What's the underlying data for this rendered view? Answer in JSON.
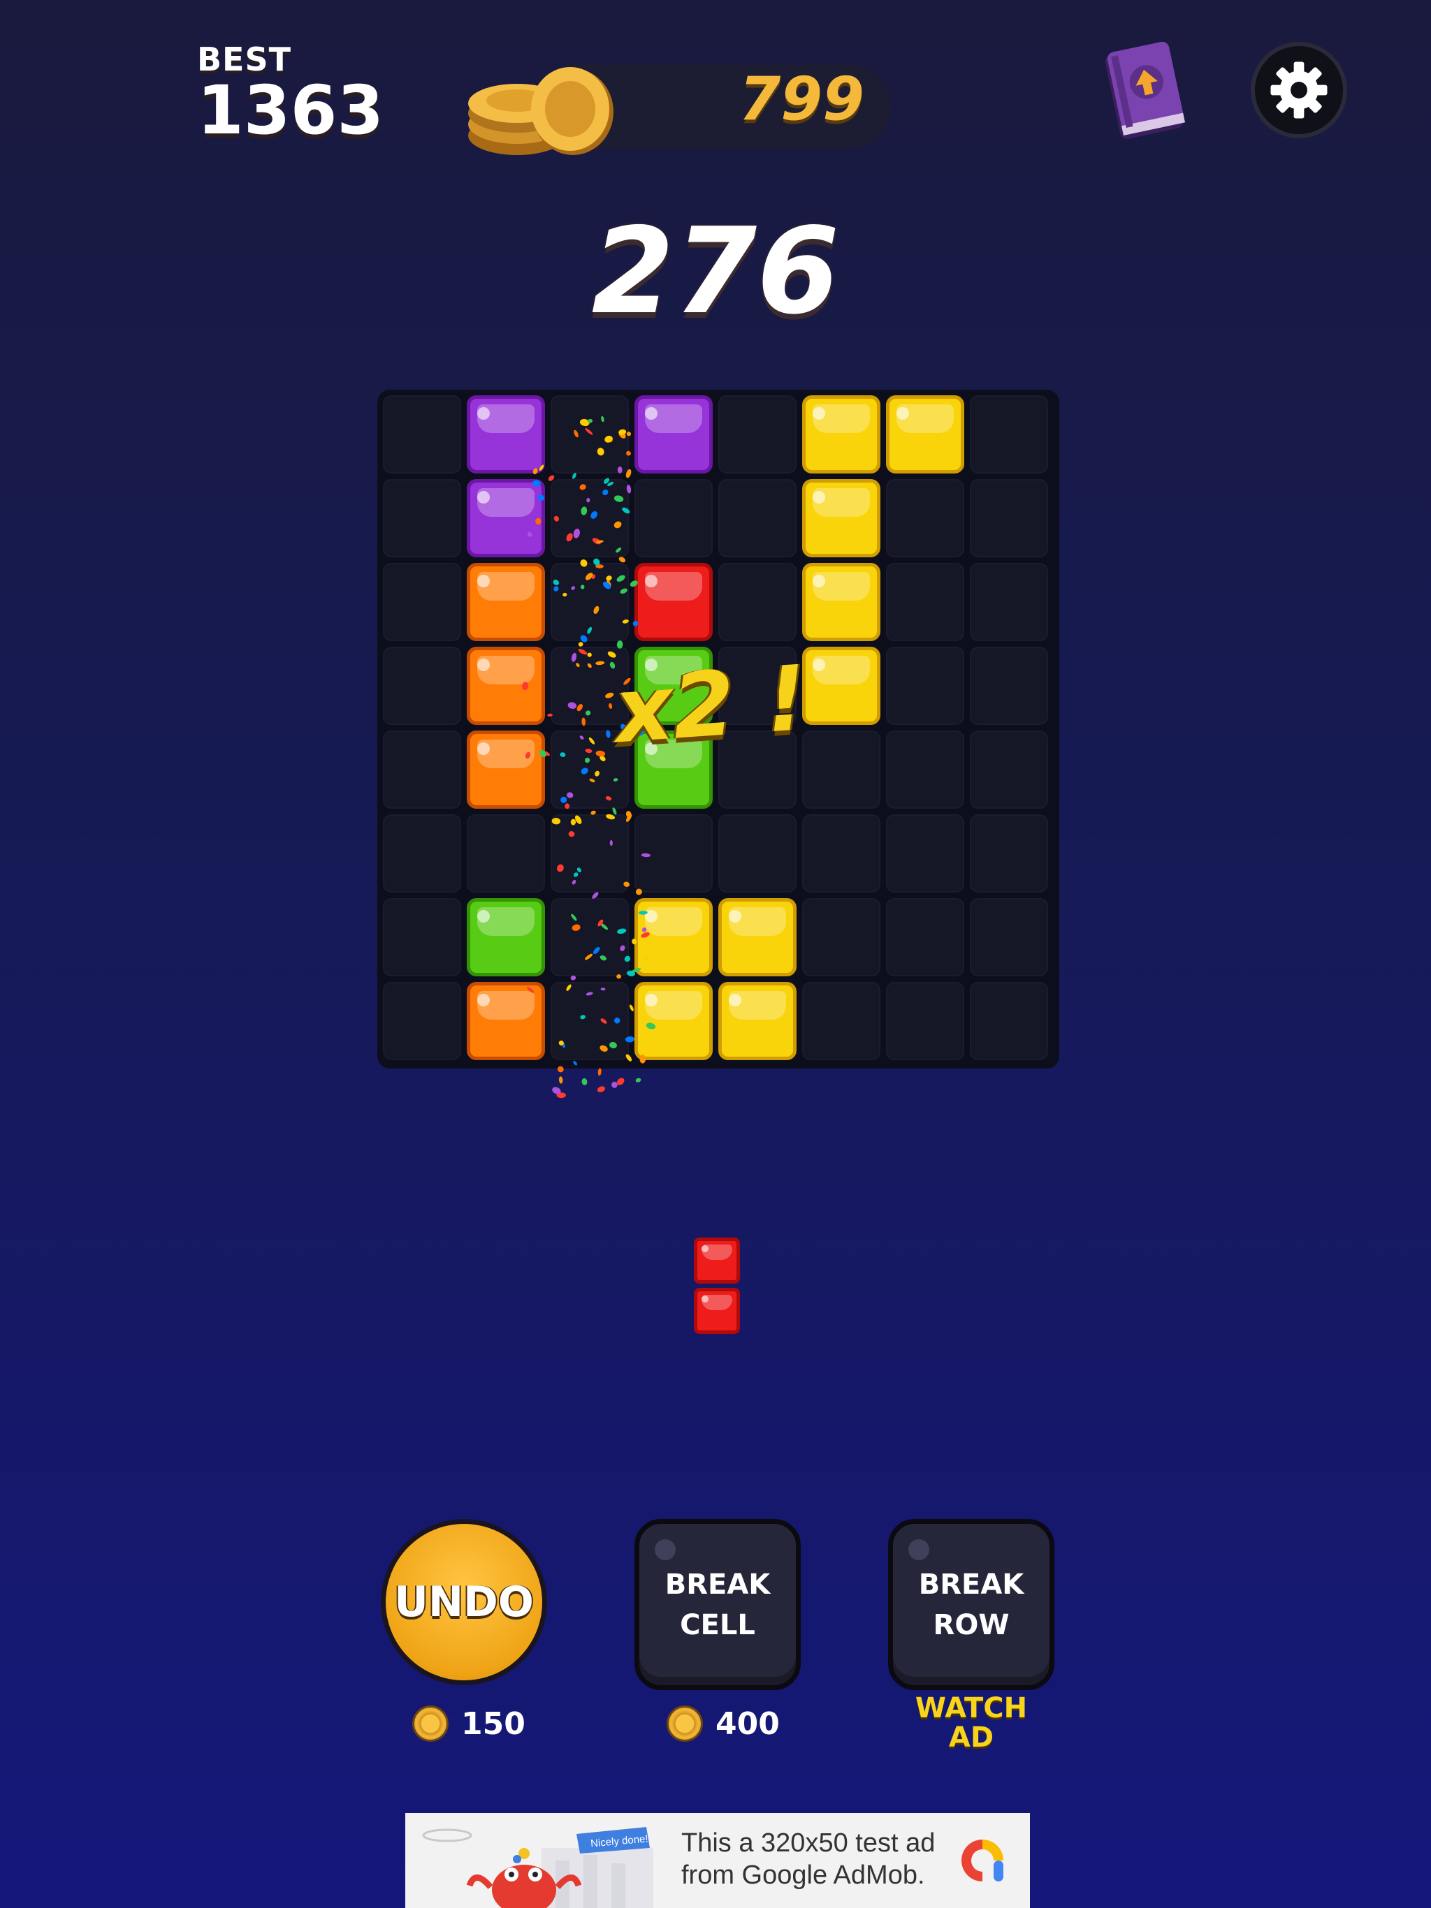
{
  "header": {
    "best_label": "BEST",
    "best_value": "1363",
    "coins": "799",
    "rulebook_icon": "book-up-arrow-icon",
    "settings_icon": "gear-icon"
  },
  "score": "276",
  "combo_text": "x2 !",
  "board": {
    "rows": 8,
    "cols": 8,
    "cells": [
      [
        "",
        "purple",
        "",
        "purple",
        "",
        "yellow",
        "yellow",
        ""
      ],
      [
        "",
        "purple",
        "",
        "",
        "",
        "yellow",
        "",
        ""
      ],
      [
        "",
        "orange",
        "",
        "red",
        "",
        "yellow",
        "",
        ""
      ],
      [
        "",
        "orange",
        "",
        "green",
        "",
        "yellow",
        "",
        ""
      ],
      [
        "",
        "orange",
        "",
        "green",
        "",
        "",
        "",
        ""
      ],
      [
        "",
        "",
        "",
        "",
        "",
        "",
        "",
        ""
      ],
      [
        "",
        "green",
        "",
        "yellow",
        "yellow",
        "",
        "",
        ""
      ],
      [
        "",
        "orange",
        "",
        "yellow",
        "yellow",
        "",
        "",
        ""
      ]
    ]
  },
  "next_piece": {
    "color": "red",
    "shape": [
      [
        1
      ],
      [
        1
      ]
    ]
  },
  "powerups": {
    "undo": {
      "label": "UNDO",
      "cost": "150"
    },
    "break_cell": {
      "label": "BREAK\nCELL",
      "cost": "400"
    },
    "break_row": {
      "label": "BREAK\nROW",
      "action": "WATCH\nAD"
    }
  },
  "ad": {
    "text": "This a 320x50 test ad\nfrom Google AdMob.",
    "badge": "Nicely done!"
  },
  "colors": {
    "purple": "#9633d9",
    "yellow": "#f9d40b",
    "orange": "#ff7c06",
    "red": "#ef1c1c",
    "green": "#58cc14",
    "coin_gold": "#f4b93a"
  }
}
